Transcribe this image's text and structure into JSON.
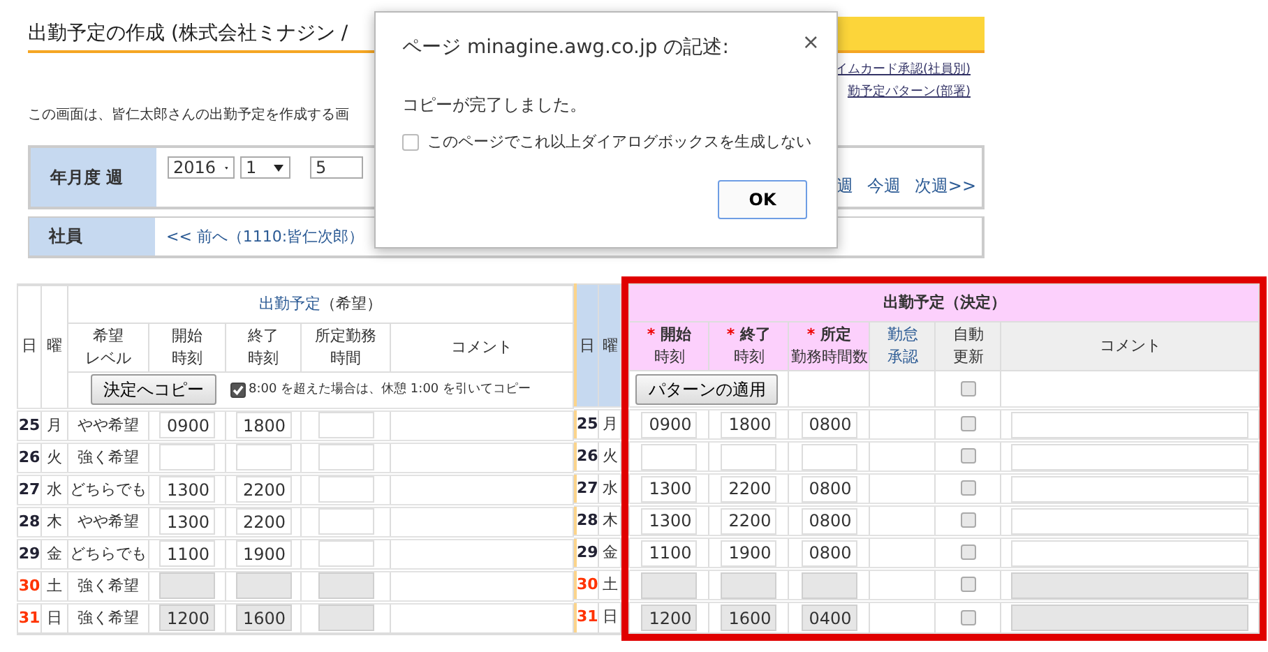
{
  "page": {
    "title": "出勤予定の作成 (株式会社ミナジン /",
    "links": [
      "イムカード承認(社員別)",
      "勤予定パターン(部署)"
    ],
    "description": "この画面は、皆仁太郎さんの出勤予定を作成する画"
  },
  "week_selector": {
    "label": "年月度 週",
    "selects": [
      "2016",
      "1",
      "5"
    ],
    "nav": [
      "週",
      "今週",
      "次週>>"
    ]
  },
  "employee": {
    "label": "社員",
    "prev_link": "<< 前へ（1110:皆仁次郎）"
  },
  "wish_table": {
    "group_link": "出勤予定",
    "group_suffix": "（希望）",
    "columns": [
      [
        "日"
      ],
      [
        "曜"
      ],
      [
        "希望",
        "レベル"
      ],
      [
        "開始",
        "時刻"
      ],
      [
        "終了",
        "時刻"
      ],
      [
        "所定勤務",
        "時間"
      ],
      [
        "コメント"
      ]
    ],
    "copy_button": "決定へコピー",
    "copy_option": {
      "label": "8:00 を超えた場合は、休憩 1:00 を引いてコピー",
      "checked": true
    },
    "rows": [
      {
        "day": "25",
        "weekday": "月",
        "holiday": false,
        "level": "やや希望",
        "start": "0900",
        "end": "1800",
        "disabled": false
      },
      {
        "day": "26",
        "weekday": "火",
        "holiday": false,
        "level": "強く希望",
        "disabled": false
      },
      {
        "day": "27",
        "weekday": "水",
        "holiday": false,
        "level": "どちらでも",
        "start": "1300",
        "end": "2200",
        "disabled": false
      },
      {
        "day": "28",
        "weekday": "木",
        "holiday": false,
        "level": "やや希望",
        "start": "1300",
        "end": "2200",
        "disabled": false
      },
      {
        "day": "29",
        "weekday": "金",
        "holiday": false,
        "level": "どちらでも",
        "start": "1100",
        "end": "1900",
        "disabled": false
      },
      {
        "day": "30",
        "weekday": "土",
        "holiday": true,
        "level": "強く希望",
        "disabled": true
      },
      {
        "day": "31",
        "weekday": "日",
        "holiday": true,
        "level": "強く希望",
        "start": "1200",
        "end": "1600",
        "disabled": true
      }
    ]
  },
  "decision_table": {
    "day_columns": [
      "日",
      "曜"
    ],
    "title": "出勤予定（決定）",
    "columns": [
      {
        "kind": "required",
        "mark": "*",
        "label": "開始",
        "sub": "時刻"
      },
      {
        "kind": "required",
        "mark": "*",
        "label": "終了",
        "sub": "時刻"
      },
      {
        "kind": "required",
        "mark": "*",
        "label": "所定",
        "sub": "勤務時間数"
      },
      {
        "kind": "link",
        "lines": [
          "勤怠",
          "承認"
        ]
      },
      {
        "kind": "plain",
        "lines": [
          "自動",
          "更新"
        ]
      },
      {
        "kind": "plain",
        "lines": [
          "コメント"
        ]
      }
    ],
    "apply_button": "パターンの適用",
    "auto_update_all": false,
    "rows": [
      {
        "day": "25",
        "weekday": "月",
        "holiday": false,
        "start": "0900",
        "end": "1800",
        "hours": "0800",
        "auto_update": false,
        "disabled": false
      },
      {
        "day": "26",
        "weekday": "火",
        "holiday": false,
        "auto_update": false,
        "disabled": false
      },
      {
        "day": "27",
        "weekday": "水",
        "holiday": false,
        "start": "1300",
        "end": "2200",
        "hours": "0800",
        "auto_update": false,
        "disabled": false
      },
      {
        "day": "28",
        "weekday": "木",
        "holiday": false,
        "start": "1300",
        "end": "2200",
        "hours": "0800",
        "auto_update": false,
        "disabled": false
      },
      {
        "day": "29",
        "weekday": "金",
        "holiday": false,
        "start": "1100",
        "end": "1900",
        "hours": "0800",
        "auto_update": false,
        "disabled": false
      },
      {
        "day": "30",
        "weekday": "土",
        "holiday": true,
        "auto_update": false,
        "disabled": true
      },
      {
        "day": "31",
        "weekday": "日",
        "holiday": true,
        "start": "1200",
        "end": "1600",
        "hours": "0400",
        "auto_update": false,
        "disabled": true
      }
    ]
  },
  "dialog": {
    "title": "ページ minagine.awg.co.jp の記述:",
    "close": "×",
    "message": "コピーが完了しました。",
    "option": {
      "label": "このページでこれ以上ダイアログボックスを生成しない",
      "checked": false
    },
    "ok_button": "OK"
  }
}
